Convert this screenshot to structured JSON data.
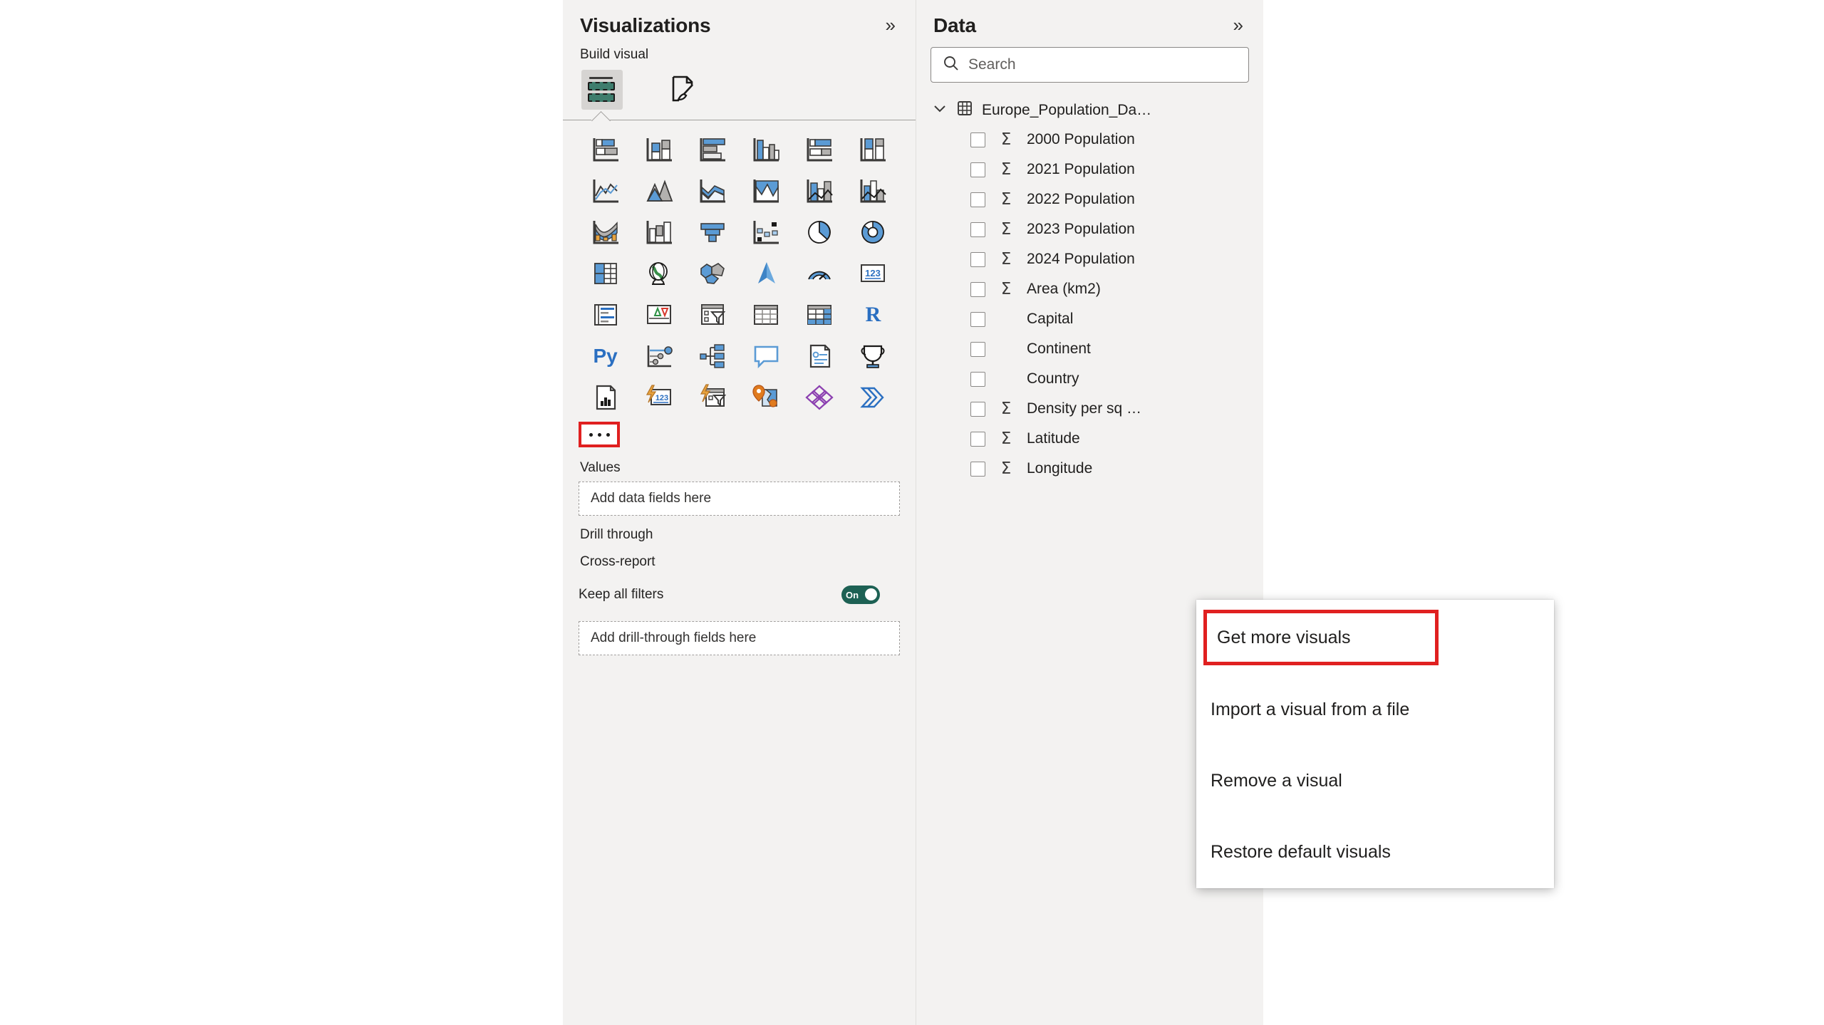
{
  "visualizations": {
    "title": "Visualizations",
    "collapse_label": "»",
    "build_visual_label": "Build visual",
    "tabs": [
      {
        "name": "build-visual-tab",
        "icon": "fields-icon",
        "active": true
      },
      {
        "name": "format-visual-tab",
        "icon": "paintbrush-page-icon",
        "active": false
      }
    ],
    "visual_types": [
      "stacked-bar-chart",
      "stacked-column-chart",
      "clustered-bar-chart",
      "clustered-column-chart",
      "100-percent-stacked-bar-chart",
      "100-percent-stacked-column-chart",
      "line-chart",
      "area-chart",
      "stacked-area-chart",
      "line-and-stacked-column-chart-alt",
      "line-and-stacked-column-chart",
      "line-and-clustered-column-chart",
      "ribbon-chart",
      "waterfall-chart",
      "funnel-chart",
      "scatter-chart",
      "pie-chart",
      "donut-chart",
      "treemap",
      "map",
      "filled-map",
      "azure-map",
      "gauge-chart",
      "card",
      "multi-row-card",
      "kpi",
      "slicer",
      "table",
      "matrix",
      "r-script-visual",
      "python-visual",
      "key-influencers",
      "decomposition-tree",
      "qa-visual",
      "narrative",
      "metrics",
      "paginated-report",
      "power-apps",
      "power-automate",
      "arcgis-maps",
      "azure-machine-learning",
      "powerpoint-visual"
    ],
    "more_options_label": "…",
    "wells": [
      {
        "label": "Values",
        "placeholder": "Add data fields here"
      },
      {
        "label": "Drill through",
        "placeholder": ""
      },
      {
        "label": "Cross-report",
        "placeholder": ""
      }
    ],
    "keep_all_filters": {
      "label": "Keep all filters",
      "state": "On"
    },
    "drill_through_dropzone": "Add drill-through fields here"
  },
  "context_menu": {
    "items": [
      {
        "label": "Get more visuals",
        "highlighted": true
      },
      {
        "label": "Import a visual from a file",
        "highlighted": false
      },
      {
        "label": "Remove a visual",
        "highlighted": false
      },
      {
        "label": "Restore default visuals",
        "highlighted": false
      }
    ]
  },
  "data": {
    "title": "Data",
    "collapse_label": "»",
    "search": {
      "placeholder": "Search",
      "value": ""
    },
    "table": {
      "name": "Europe_Population_Da…",
      "expanded": true,
      "fields": [
        {
          "label": "2000 Population",
          "aggregate": true,
          "checked": false
        },
        {
          "label": "2021 Population",
          "aggregate": true,
          "checked": false
        },
        {
          "label": "2022 Population",
          "aggregate": true,
          "checked": false
        },
        {
          "label": "2023 Population",
          "aggregate": true,
          "checked": false
        },
        {
          "label": "2024 Population",
          "aggregate": true,
          "checked": false
        },
        {
          "label": "Area (km2)",
          "aggregate": true,
          "checked": false
        },
        {
          "label": "Capital",
          "aggregate": false,
          "checked": false
        },
        {
          "label": "Continent",
          "aggregate": false,
          "checked": false
        },
        {
          "label": "Country",
          "aggregate": false,
          "checked": false
        },
        {
          "label": "Density per sq …",
          "aggregate": true,
          "checked": false
        },
        {
          "label": "Latitude",
          "aggregate": true,
          "checked": false
        },
        {
          "label": "Longitude",
          "aggregate": true,
          "checked": false
        }
      ]
    }
  },
  "colors": {
    "panel_bg": "#f3f2f1",
    "accent_blue": "#5b9bd5",
    "highlight_red": "#e02020",
    "toggle_on_green": "#1d6154",
    "build_icon_green": "#3e7d6d"
  }
}
